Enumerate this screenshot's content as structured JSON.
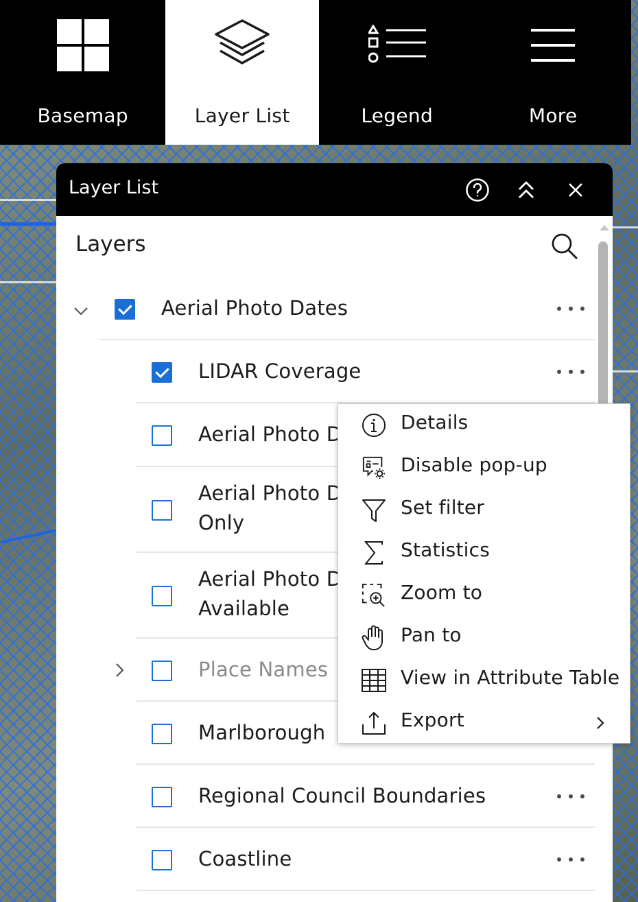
{
  "toolbar": {
    "items": [
      {
        "label": "Basemap",
        "icon": "grid-icon",
        "active": false
      },
      {
        "label": "Layer List",
        "icon": "layers-icon",
        "active": true
      },
      {
        "label": "Legend",
        "icon": "legend-icon",
        "active": false
      },
      {
        "label": "More",
        "icon": "menu-icon",
        "active": false
      }
    ]
  },
  "panel": {
    "title": "Layer List",
    "help_icon": "help-icon",
    "collapse_icon": "chevrons-up-icon",
    "close_icon": "close-icon",
    "section_title": "Layers",
    "search_icon": "search-icon"
  },
  "layers": [
    {
      "label": "Aerial Photo Dates",
      "checked": true,
      "expandable": "expanded",
      "has_actions": true
    },
    {
      "label": "LIDAR Coverage",
      "checked": true,
      "has_actions": true
    },
    {
      "label": "Aerial Photo D",
      "checked": false
    },
    {
      "label_line1": "Aerial Photo D",
      "label_line2": "Only",
      "checked": false
    },
    {
      "label_line1": "Aerial Photo D",
      "label_line2": "Available",
      "checked": false
    },
    {
      "label": "Place Names",
      "checked": false,
      "expandable": "collapsed",
      "muted": true
    },
    {
      "label": "Marlborough",
      "checked": false
    },
    {
      "label": "Regional Council Boundaries",
      "checked": false,
      "has_actions": true
    },
    {
      "label": "Coastline",
      "checked": false,
      "has_actions": true
    }
  ],
  "context_menu": {
    "items": [
      {
        "label": "Details",
        "icon": "info-icon"
      },
      {
        "label": "Disable pop-up",
        "icon": "popup-settings-icon"
      },
      {
        "label": "Set filter",
        "icon": "filter-icon"
      },
      {
        "label": "Statistics",
        "icon": "sigma-icon"
      },
      {
        "label": "Zoom to",
        "icon": "zoom-to-icon"
      },
      {
        "label": "Pan to",
        "icon": "hand-icon"
      },
      {
        "label": "View in Attribute Table",
        "icon": "table-icon"
      },
      {
        "label": "Export",
        "icon": "export-icon",
        "has_submenu": true
      }
    ]
  },
  "colors": {
    "accent": "#1a6fd6",
    "toolbar_bg": "#000000",
    "map_hatch": "#286ee6"
  }
}
